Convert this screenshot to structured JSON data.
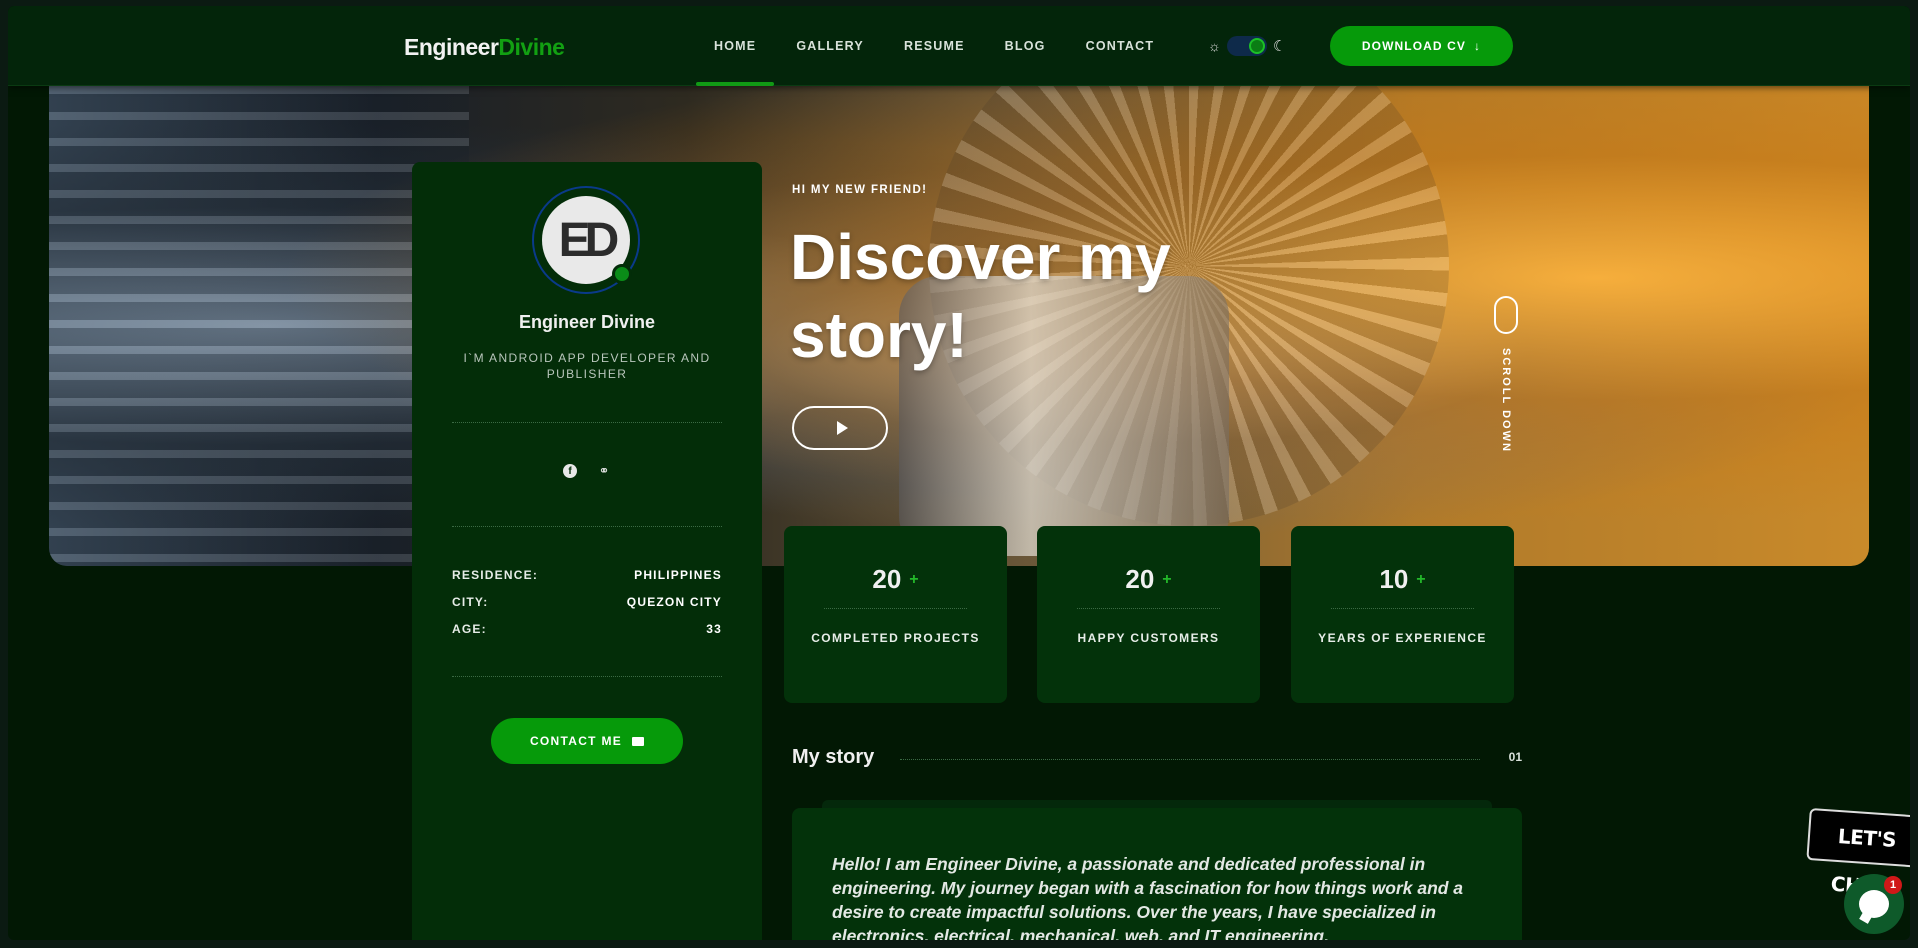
{
  "header": {
    "logo_part1": "Engineer",
    "logo_part2": "Divine",
    "nav": [
      "HOME",
      "GALLERY",
      "RESUME",
      "BLOG",
      "CONTACT"
    ],
    "active_nav": "HOME",
    "theme_toggle": "dark",
    "download_label": "DOWNLOAD CV"
  },
  "hero": {
    "kicker": "HI MY NEW FRIEND!",
    "title": "Discover my story!",
    "scroll_label": "SCROLL DOWN"
  },
  "profile": {
    "avatar_text": "ED",
    "name": "Engineer Divine",
    "role": "I`M ANDROID APP DEVELOPER AND PUBLISHER",
    "social": [
      "facebook-icon",
      "link-icon"
    ],
    "info": [
      {
        "key": "RESIDENCE:",
        "value": "PHILIPPINES"
      },
      {
        "key": "CITY:",
        "value": "QUEZON CITY"
      },
      {
        "key": "AGE:",
        "value": "33"
      }
    ],
    "contact_label": "CONTACT ME"
  },
  "stats": [
    {
      "value": "20",
      "suffix": "+",
      "label": "COMPLETED PROJECTS"
    },
    {
      "value": "20",
      "suffix": "+",
      "label": "HAPPY CUSTOMERS"
    },
    {
      "value": "10",
      "suffix": "+",
      "label": "YEARS OF EXPERIENCE"
    }
  ],
  "story": {
    "title": "My story",
    "number": "01",
    "text": "Hello! I am Engineer Divine, a passionate and dedicated professional in engineering. My journey began with a fascination for how things work and a desire to create impactful solutions. Over the years, I have specialized in electronics, electrical, mechanical, web, and IT engineering."
  },
  "chat": {
    "bubble": "LET'S CHAT!",
    "badge": "1"
  },
  "colors": {
    "accent": "#069a0a",
    "logo_accent": "#12a012",
    "card_bg": "#03320a",
    "page_bg": "#021804"
  }
}
